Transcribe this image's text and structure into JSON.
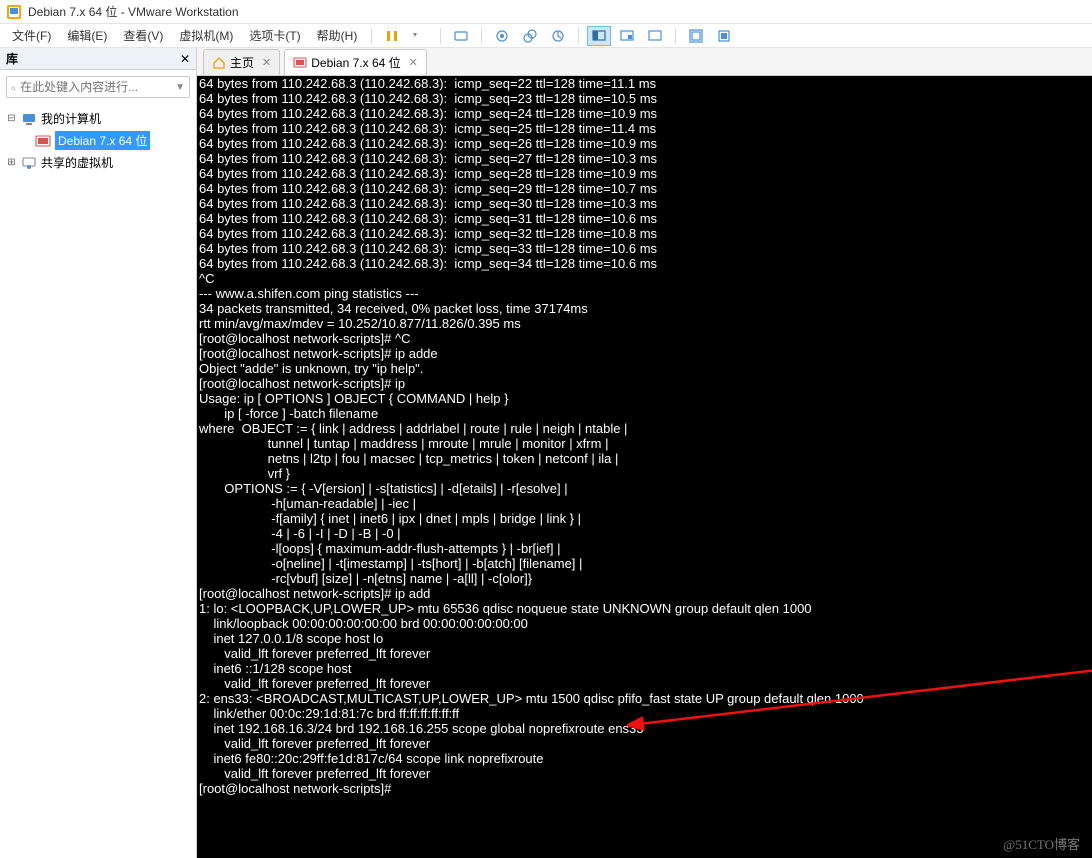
{
  "window": {
    "title": "Debian 7.x 64 位 - VMware Workstation"
  },
  "menu": {
    "items": [
      "文件(F)",
      "编辑(E)",
      "查看(V)",
      "虚拟机(M)",
      "选项卡(T)",
      "帮助(H)"
    ]
  },
  "sidebar": {
    "title": "库",
    "search_placeholder": "在此处键入内容进行...",
    "nodes": {
      "root": "我的计算机",
      "child": "Debian 7.x 64 位",
      "shared": "共享的虚拟机"
    }
  },
  "tabs": {
    "home": "主页",
    "vm": "Debian 7.x 64 位"
  },
  "watermark": "@51CTO博客",
  "terminal_lines": [
    "64 bytes from 110.242.68.3 (110.242.68.3):  icmp_seq=22 ttl=128 time=11.1 ms",
    "64 bytes from 110.242.68.3 (110.242.68.3):  icmp_seq=23 ttl=128 time=10.5 ms",
    "64 bytes from 110.242.68.3 (110.242.68.3):  icmp_seq=24 ttl=128 time=10.9 ms",
    "64 bytes from 110.242.68.3 (110.242.68.3):  icmp_seq=25 ttl=128 time=11.4 ms",
    "64 bytes from 110.242.68.3 (110.242.68.3):  icmp_seq=26 ttl=128 time=10.9 ms",
    "64 bytes from 110.242.68.3 (110.242.68.3):  icmp_seq=27 ttl=128 time=10.3 ms",
    "64 bytes from 110.242.68.3 (110.242.68.3):  icmp_seq=28 ttl=128 time=10.9 ms",
    "64 bytes from 110.242.68.3 (110.242.68.3):  icmp_seq=29 ttl=128 time=10.7 ms",
    "64 bytes from 110.242.68.3 (110.242.68.3):  icmp_seq=30 ttl=128 time=10.3 ms",
    "64 bytes from 110.242.68.3 (110.242.68.3):  icmp_seq=31 ttl=128 time=10.6 ms",
    "64 bytes from 110.242.68.3 (110.242.68.3):  icmp_seq=32 ttl=128 time=10.8 ms",
    "64 bytes from 110.242.68.3 (110.242.68.3):  icmp_seq=33 ttl=128 time=10.6 ms",
    "64 bytes from 110.242.68.3 (110.242.68.3):  icmp_seq=34 ttl=128 time=10.6 ms",
    "^C",
    "--- www.a.shifen.com ping statistics ---",
    "34 packets transmitted, 34 received, 0% packet loss, time 37174ms",
    "rtt min/avg/max/mdev = 10.252/10.877/11.826/0.395 ms",
    "[root@localhost network-scripts]# ^C",
    "[root@localhost network-scripts]# ip adde",
    "Object \"adde\" is unknown, try \"ip help\".",
    "[root@localhost network-scripts]# ip",
    "Usage: ip [ OPTIONS ] OBJECT { COMMAND | help }",
    "       ip [ -force ] -batch filename",
    "where  OBJECT := { link | address | addrlabel | route | rule | neigh | ntable |",
    "                   tunnel | tuntap | maddress | mroute | mrule | monitor | xfrm |",
    "                   netns | l2tp | fou | macsec | tcp_metrics | token | netconf | ila |",
    "                   vrf }",
    "       OPTIONS := { -V[ersion] | -s[tatistics] | -d[etails] | -r[esolve] |",
    "                    -h[uman-readable] | -iec |",
    "                    -f[amily] { inet | inet6 | ipx | dnet | mpls | bridge | link } |",
    "                    -4 | -6 | -I | -D | -B | -0 |",
    "                    -l[oops] { maximum-addr-flush-attempts } | -br[ief] |",
    "                    -o[neline] | -t[imestamp] | -ts[hort] | -b[atch] [filename] |",
    "                    -rc[vbuf] [size] | -n[etns] name | -a[ll] | -c[olor]}",
    "[root@localhost network-scripts]# ip add",
    "1: lo: <LOOPBACK,UP,LOWER_UP> mtu 65536 qdisc noqueue state UNKNOWN group default qlen 1000",
    "    link/loopback 00:00:00:00:00:00 brd 00:00:00:00:00:00",
    "    inet 127.0.0.1/8 scope host lo",
    "       valid_lft forever preferred_lft forever",
    "    inet6 ::1/128 scope host",
    "       valid_lft forever preferred_lft forever",
    "2: ens33: <BROADCAST,MULTICAST,UP,LOWER_UP> mtu 1500 qdisc pfifo_fast state UP group default qlen 1000",
    "    link/ether 00:0c:29:1d:81:7c brd ff:ff:ff:ff:ff:ff",
    "    inet 192.168.16.3/24 brd 192.168.16.255 scope global noprefixroute ens33",
    "       valid_lft forever preferred_lft forever",
    "    inet6 fe80::20c:29ff:fe1d:817c/64 scope link noprefixroute",
    "       valid_lft forever preferred_lft forever",
    "[root@localhost network-scripts]# "
  ]
}
